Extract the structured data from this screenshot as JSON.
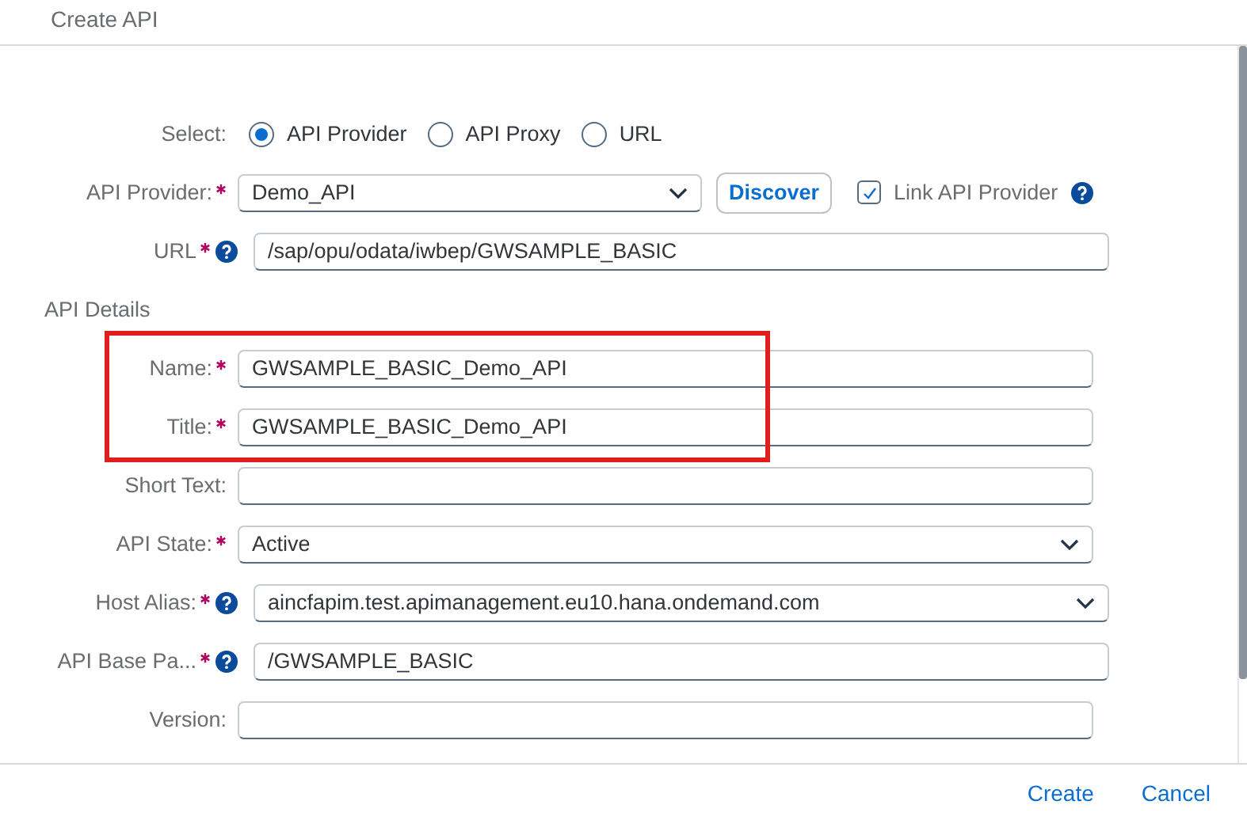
{
  "dialog": {
    "title": "Create API"
  },
  "select": {
    "label": "Select:",
    "options": [
      {
        "label": "API Provider",
        "selected": true
      },
      {
        "label": "API Proxy",
        "selected": false
      },
      {
        "label": "URL",
        "selected": false
      }
    ]
  },
  "provider_row": {
    "label": "API Provider:",
    "required": true,
    "value": "Demo_API",
    "button": "Discover",
    "link": {
      "label": "Link API Provider",
      "checked": true,
      "help": true
    }
  },
  "url_row": {
    "label": "URL",
    "required": true,
    "help": true,
    "value": "/sap/opu/odata/iwbep/GWSAMPLE_BASIC"
  },
  "section": "API Details",
  "fields": [
    {
      "label": "Name:",
      "required": true,
      "help": false,
      "kind": "text",
      "value": "GWSAMPLE_BASIC_Demo_API"
    },
    {
      "label": "Title:",
      "required": true,
      "help": false,
      "kind": "text",
      "value": "GWSAMPLE_BASIC_Demo_API"
    },
    {
      "label": "Short Text:",
      "required": false,
      "help": false,
      "kind": "text"
    },
    {
      "label": "API State:",
      "required": true,
      "help": false,
      "kind": "select",
      "value": "Active"
    },
    {
      "label": "Host Alias:",
      "required": true,
      "help": true,
      "kind": "select",
      "value": "aincfapim.test.apimanagement.eu10.hana.ondemand.com"
    },
    {
      "label": "API Base Pa...",
      "required": true,
      "help": true,
      "kind": "text",
      "value": "/GWSAMPLE_BASIC"
    },
    {
      "label": "Version:",
      "required": false,
      "help": false,
      "kind": "text"
    }
  ],
  "footer": {
    "buttons": [
      "Create",
      "Cancel"
    ]
  }
}
